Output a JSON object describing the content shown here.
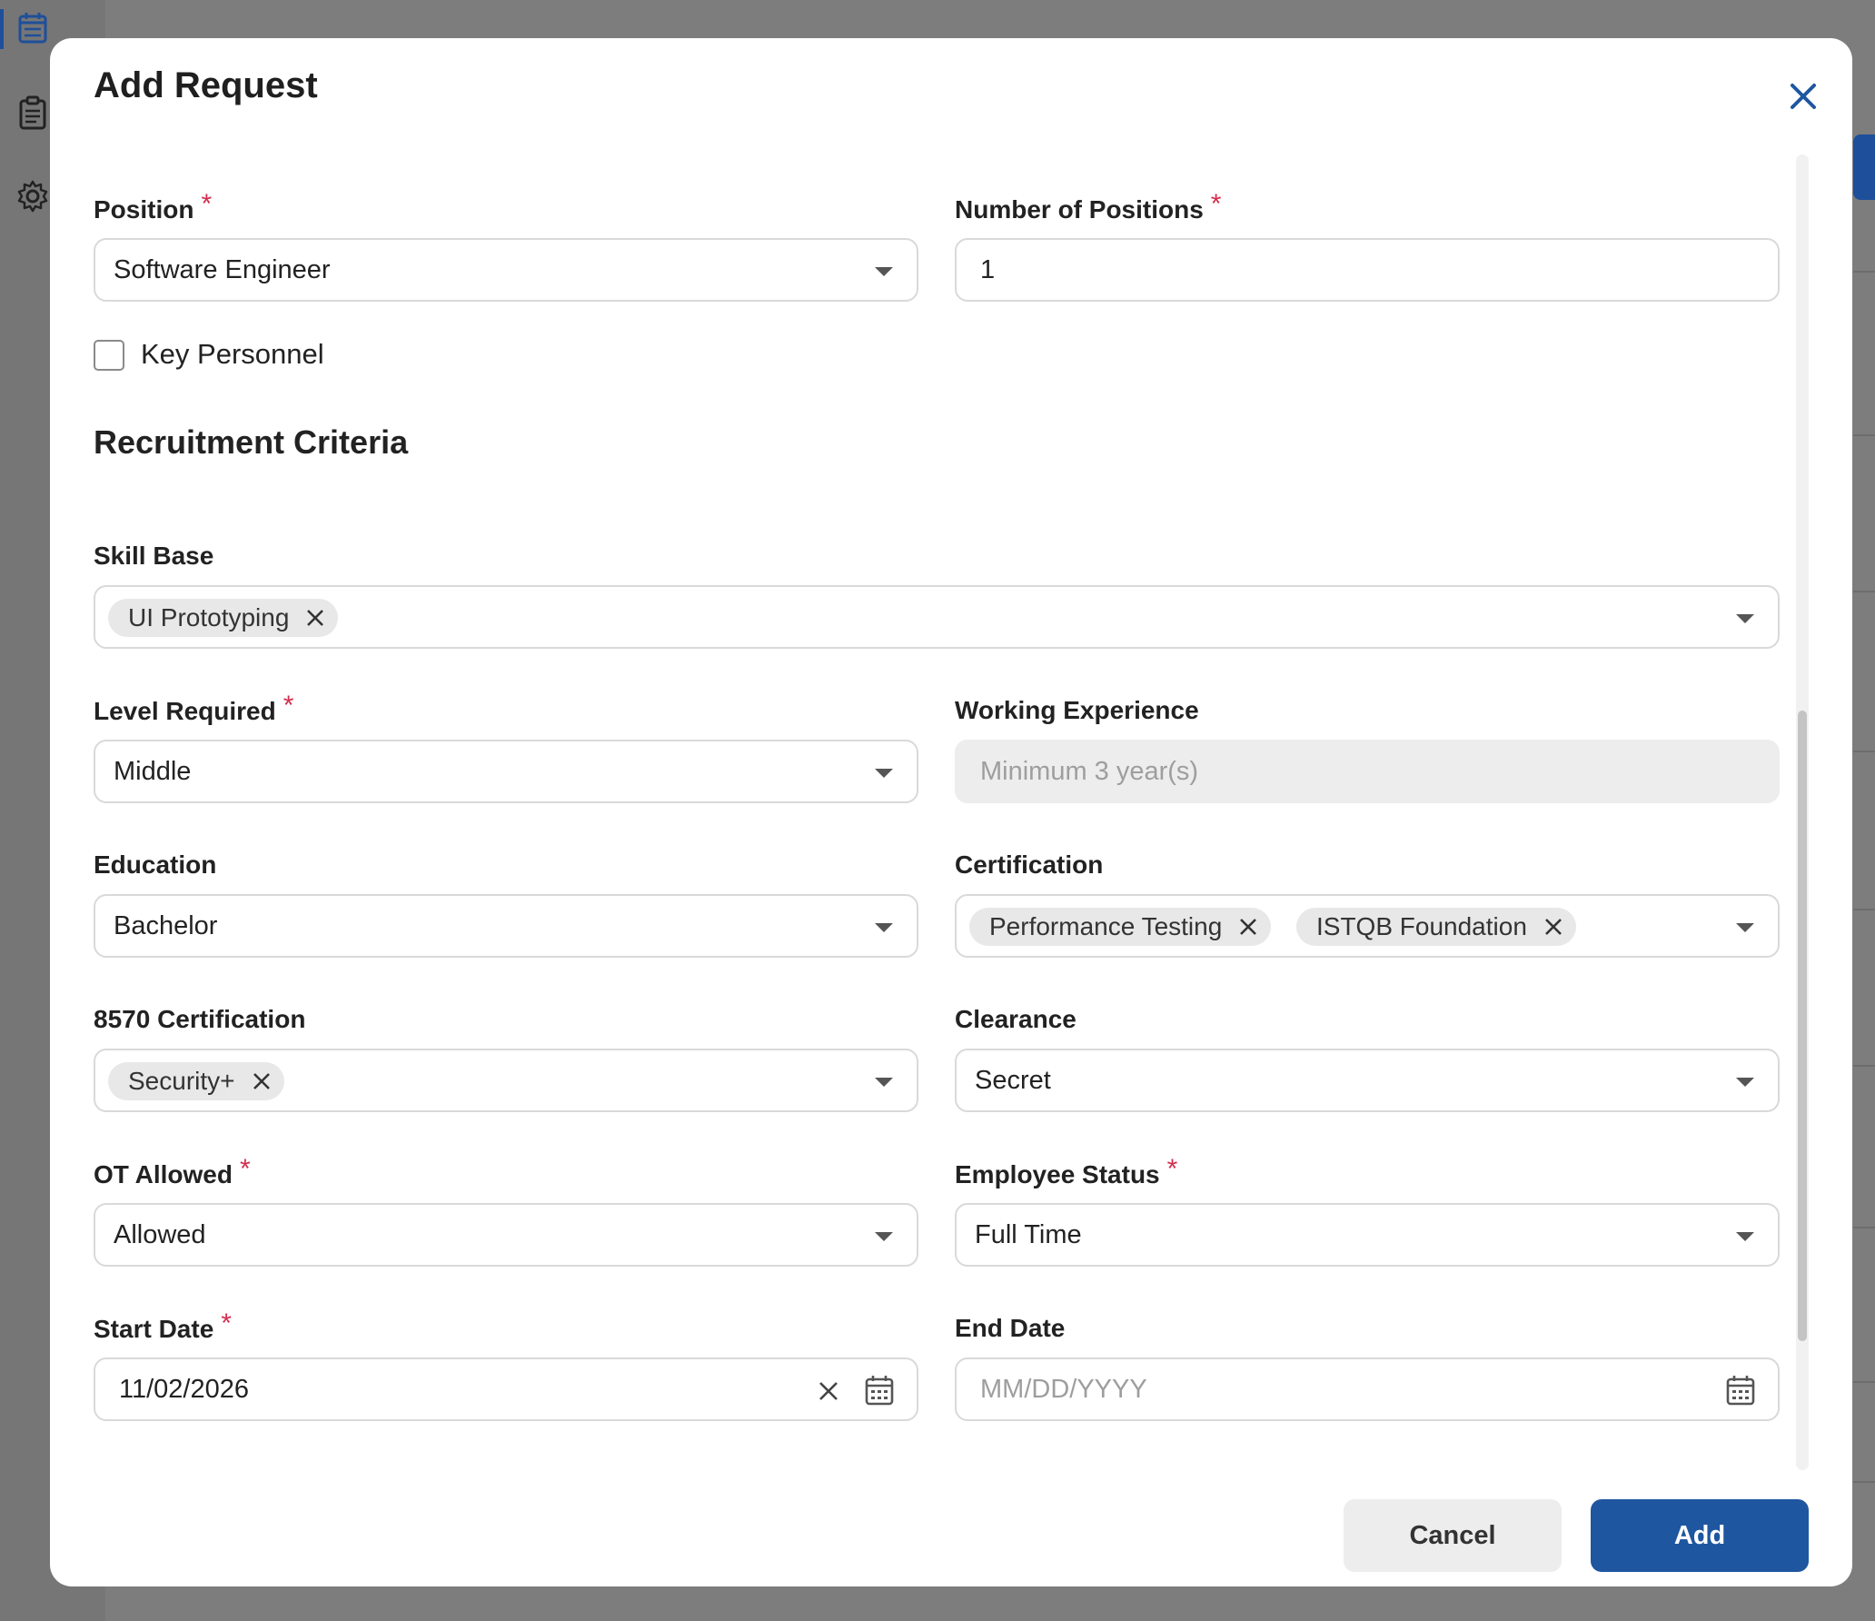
{
  "dialog": {
    "title": "Add Request"
  },
  "form": {
    "position": {
      "label": "Position",
      "value": "Software Engineer"
    },
    "num_positions": {
      "label": "Number of Positions",
      "value": "1"
    },
    "key_personnel": {
      "label": "Key Personnel",
      "checked": false
    },
    "section_title": "Recruitment Criteria",
    "skill_base": {
      "label": "Skill Base",
      "chips": [
        "UI Prototyping"
      ]
    },
    "level_required": {
      "label": "Level Required",
      "value": "Middle"
    },
    "working_experience": {
      "label": "Working Experience",
      "placeholder": "Minimum 3 year(s)"
    },
    "education": {
      "label": "Education",
      "value": "Bachelor"
    },
    "certification": {
      "label": "Certification",
      "chips": [
        "Performance Testing",
        "ISTQB Foundation"
      ]
    },
    "cert_8570": {
      "label": "8570 Certification",
      "chips": [
        "Security+"
      ]
    },
    "clearance": {
      "label": "Clearance",
      "value": "Secret"
    },
    "ot_allowed": {
      "label": "OT Allowed",
      "value": "Allowed"
    },
    "employee_status": {
      "label": "Employee Status",
      "value": "Full Time"
    },
    "start_date": {
      "label": "Start Date",
      "value": "11/02/2026"
    },
    "end_date": {
      "label": "End Date",
      "placeholder": "MM/DD/YYYY"
    }
  },
  "required_marker": "*",
  "buttons": {
    "cancel": "Cancel",
    "add": "Add"
  },
  "colors": {
    "primary": "#1e56a0",
    "required": "#d32f4e",
    "overlay": "#7d7d7d"
  },
  "icons": [
    "calendar-icon",
    "clipboard-icon",
    "gear-icon",
    "close-icon",
    "chevron-down-icon",
    "chip-remove-icon",
    "clear-icon"
  ]
}
